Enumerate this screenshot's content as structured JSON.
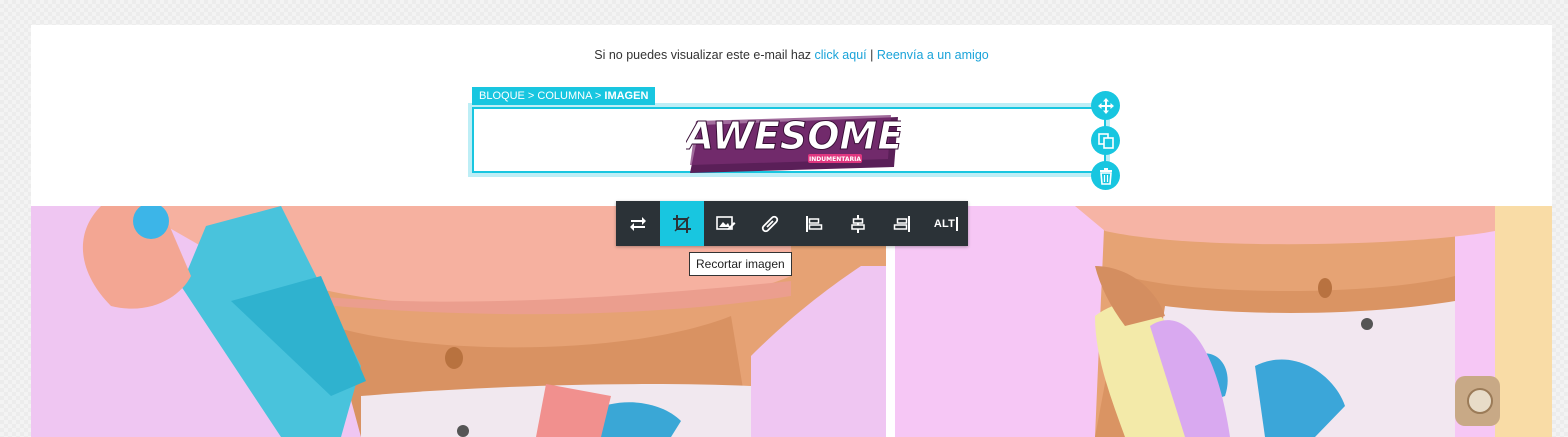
{
  "preheader": {
    "text": "Si no puedes visualizar este e-mail haz",
    "click_link": "click aquí",
    "separator": "|",
    "forward_link": "Reenvía a un amigo"
  },
  "breadcrumb": {
    "part1": "BLOQUE",
    "sep": ">",
    "part2": "COLUMNA",
    "current": "IMAGEN"
  },
  "logo": {
    "word": "AWESOME",
    "tag": "INDUMENTARIA"
  },
  "side_controls": [
    {
      "name": "move",
      "icon": "move-icon"
    },
    {
      "name": "duplicate",
      "icon": "duplicate-icon"
    },
    {
      "name": "delete",
      "icon": "trash-icon"
    }
  ],
  "toolbar": {
    "buttons": [
      {
        "name": "replace",
        "icon": "replace-icon"
      },
      {
        "name": "crop",
        "icon": "crop-icon",
        "active": true
      },
      {
        "name": "edit-image",
        "icon": "edit-image-icon"
      },
      {
        "name": "link",
        "icon": "link-icon"
      },
      {
        "name": "align-left",
        "icon": "align-left-icon"
      },
      {
        "name": "align-center",
        "icon": "align-center-icon"
      },
      {
        "name": "align-right",
        "icon": "align-right-icon"
      },
      {
        "name": "alt",
        "icon": "alt-text-icon"
      }
    ],
    "alt_label": "ALT"
  },
  "tooltip": "Recortar imagen",
  "colors": {
    "accent": "#18c6e0",
    "toolbar_bg": "#2b3237",
    "link": "#1aa3d9",
    "logo_purple": "#5a1f58",
    "logo_pink": "#e0367f"
  }
}
